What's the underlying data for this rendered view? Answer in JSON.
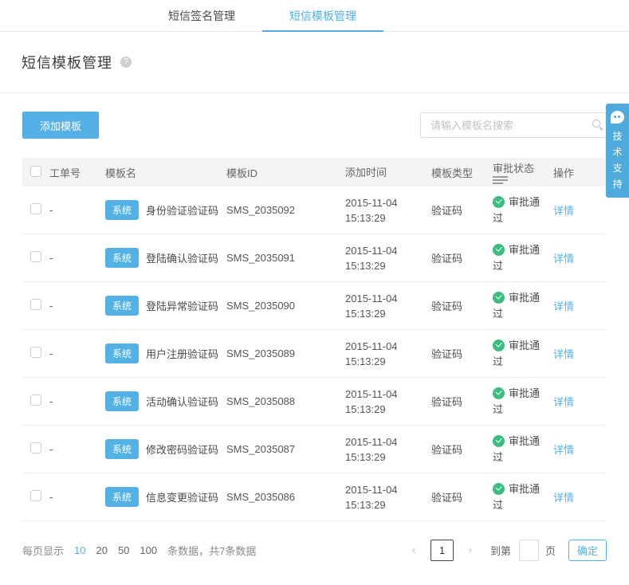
{
  "colors": {
    "accent": "#54b1e5",
    "success": "#3dbd7d",
    "header_bg": "#f4f4f4"
  },
  "tabs": [
    {
      "label": "短信签名管理",
      "active": false
    },
    {
      "label": "短信模板管理",
      "active": true
    }
  ],
  "page": {
    "title": "短信模板管理",
    "help_icon": "?"
  },
  "toolbar": {
    "add_button": "添加模板",
    "search_placeholder": "请输入模板名搜索",
    "search_value": ""
  },
  "support_widget": {
    "label": "技术支持",
    "chars": [
      "技",
      "术",
      "支",
      "持"
    ]
  },
  "table": {
    "headers": {
      "order_no": "工单号",
      "name": "模板名",
      "template_id": "模板ID",
      "added_time": "添加时间",
      "template_type": "模板类型",
      "approval_status": "审批状态",
      "actions": "操作"
    },
    "rows": [
      {
        "order_no": "-",
        "badge": "系统",
        "name": "身份验证验证码",
        "template_id": "SMS_2035092",
        "date": "2015-11-04",
        "time": "15:13:29",
        "type": "验证码",
        "status": "审批通过",
        "action": "详情"
      },
      {
        "order_no": "-",
        "badge": "系统",
        "name": "登陆确认验证码",
        "template_id": "SMS_2035091",
        "date": "2015-11-04",
        "time": "15:13:29",
        "type": "验证码",
        "status": "审批通过",
        "action": "详情"
      },
      {
        "order_no": "-",
        "badge": "系统",
        "name": "登陆异常验证码",
        "template_id": "SMS_2035090",
        "date": "2015-11-04",
        "time": "15:13:29",
        "type": "验证码",
        "status": "审批通过",
        "action": "详情"
      },
      {
        "order_no": "-",
        "badge": "系统",
        "name": "用户注册验证码",
        "template_id": "SMS_2035089",
        "date": "2015-11-04",
        "time": "15:13:29",
        "type": "验证码",
        "status": "审批通过",
        "action": "详情"
      },
      {
        "order_no": "-",
        "badge": "系统",
        "name": "活动确认验证码",
        "template_id": "SMS_2035088",
        "date": "2015-11-04",
        "time": "15:13:29",
        "type": "验证码",
        "status": "审批通过",
        "action": "详情"
      },
      {
        "order_no": "-",
        "badge": "系统",
        "name": "修改密码验证码",
        "template_id": "SMS_2035087",
        "date": "2015-11-04",
        "time": "15:13:29",
        "type": "验证码",
        "status": "审批通过",
        "action": "详情"
      },
      {
        "order_no": "-",
        "badge": "系统",
        "name": "信息变更验证码",
        "template_id": "SMS_2035086",
        "date": "2015-11-04",
        "time": "15:13:29",
        "type": "验证码",
        "status": "审批通过",
        "action": "详情"
      }
    ]
  },
  "pagination": {
    "per_page_label": "每页显示",
    "options": [
      "10",
      "20",
      "50",
      "100"
    ],
    "active_option": "10",
    "count_suffix": "条数据，共7条数据",
    "prev_icon": "‹",
    "next_icon": "›",
    "current_page": "1",
    "goto_label": "到第",
    "goto_value": "",
    "page_label": "页",
    "confirm_button": "确定"
  }
}
